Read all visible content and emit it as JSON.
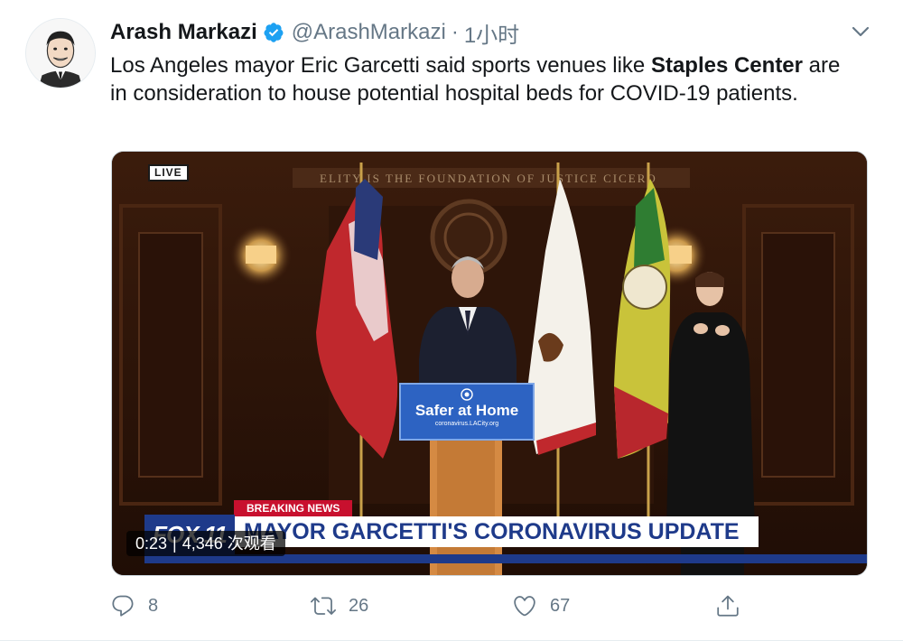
{
  "tweet": {
    "author": {
      "display_name": "Arash Markazi",
      "handle": "@ArashMarkazi",
      "verified": true,
      "avatar_icon": "avatar-caricature"
    },
    "separator": "·",
    "timestamp": "1小时",
    "text": {
      "part1": "Los Angeles mayor Eric Garcetti said sports venues like ",
      "bold": "Staples Center",
      "part2": " are in consideration to house potential hospital beds for COVID-19 patients."
    },
    "media": {
      "type": "video",
      "live_badge": "LIVE",
      "breaking_label": "BREAKING NEWS",
      "channel_logo": "FOX 11",
      "headline": "MAYOR GARCETTI'S CORONAVIRUS UPDATE",
      "podium_sign_title": "Safer at Home",
      "podium_sign_url": "coronavirus.LACity.org",
      "wall_inscription": "ELITY IS THE FOUNDATION OF JUSTICE  CICERO",
      "duration": "0:23",
      "views_separator": "|",
      "views": "4,346 次观看"
    },
    "actions": {
      "reply_count": "8",
      "retweet_count": "26",
      "like_count": "67"
    },
    "icons": {
      "verified": "verified-badge-icon",
      "caret": "chevron-down-icon",
      "reply": "reply-icon",
      "retweet": "retweet-icon",
      "like": "heart-icon",
      "share": "share-icon"
    },
    "colors": {
      "verified_blue": "#1da1f2",
      "secondary_text": "#657786",
      "primary_text": "#14171a",
      "fox_blue": "#1e3a8a",
      "breaking_red": "#c8102e"
    }
  }
}
